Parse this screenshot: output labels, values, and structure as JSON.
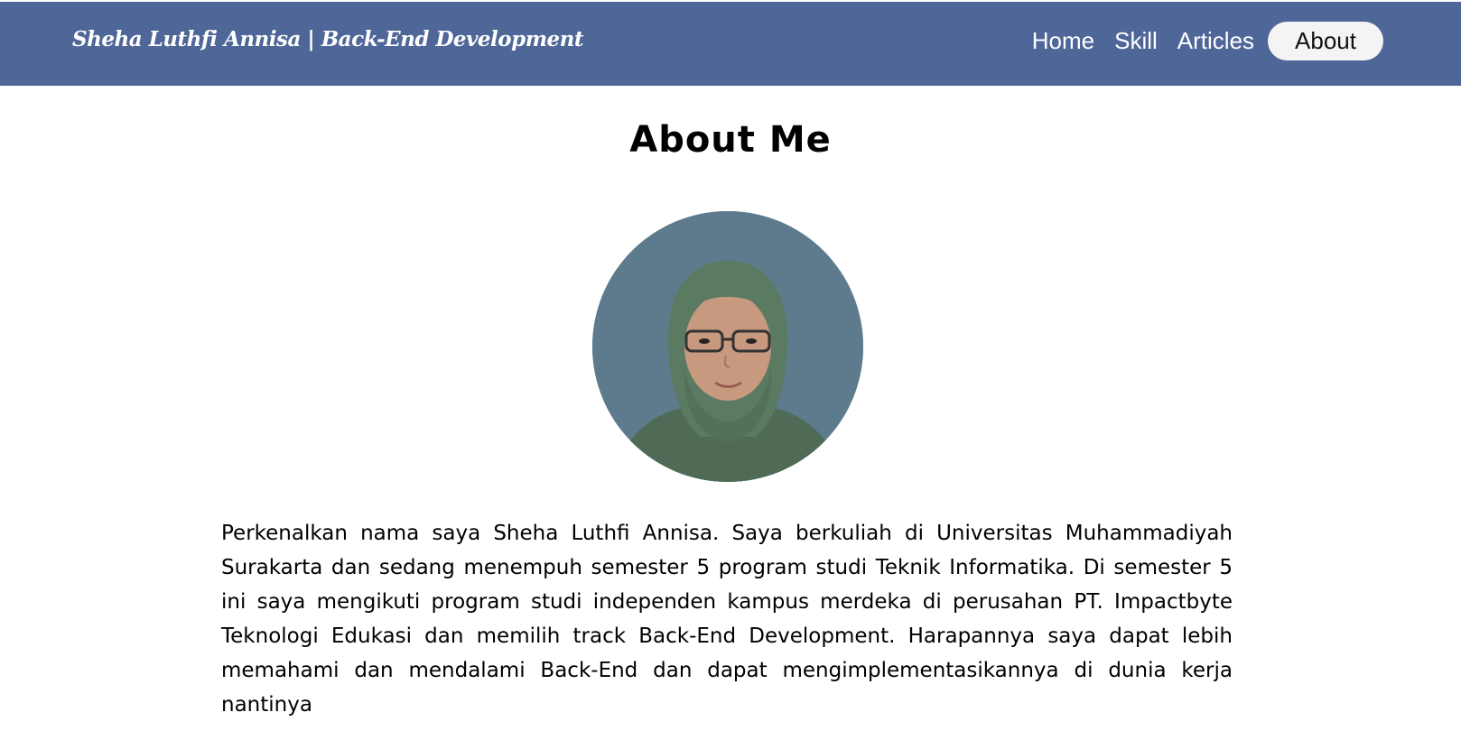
{
  "header": {
    "brand": "Sheha Luthfi Annisa | Back-End Development",
    "nav": [
      {
        "label": "Home"
      },
      {
        "label": "Skill"
      },
      {
        "label": "Articles"
      },
      {
        "label": "About",
        "active": true
      }
    ]
  },
  "main": {
    "title": "About Me",
    "avatar_icon": "profile-photo",
    "bio": "Perkenalkan nama saya Sheha Luthfi Annisa. Saya berkuliah di Universitas Muhammadiyah Surakarta dan sedang menempuh semester 5 program studi Teknik Informatika. Di semester 5 ini saya mengikuti program studi independen kampus merdeka di perusahan PT. Impactbyte Teknologi Edukasi dan memilih track Back-End Development. Harapannya saya dapat lebih memahami dan mendalami Back-End dan dapat mengimplementasikannya di dunia kerja nantinya"
  },
  "colors": {
    "navbar": "#4f6698",
    "active_pill": "#f4f4f4",
    "avatar_bg": "#5d7b8c",
    "hijab": "#5b7a62"
  }
}
